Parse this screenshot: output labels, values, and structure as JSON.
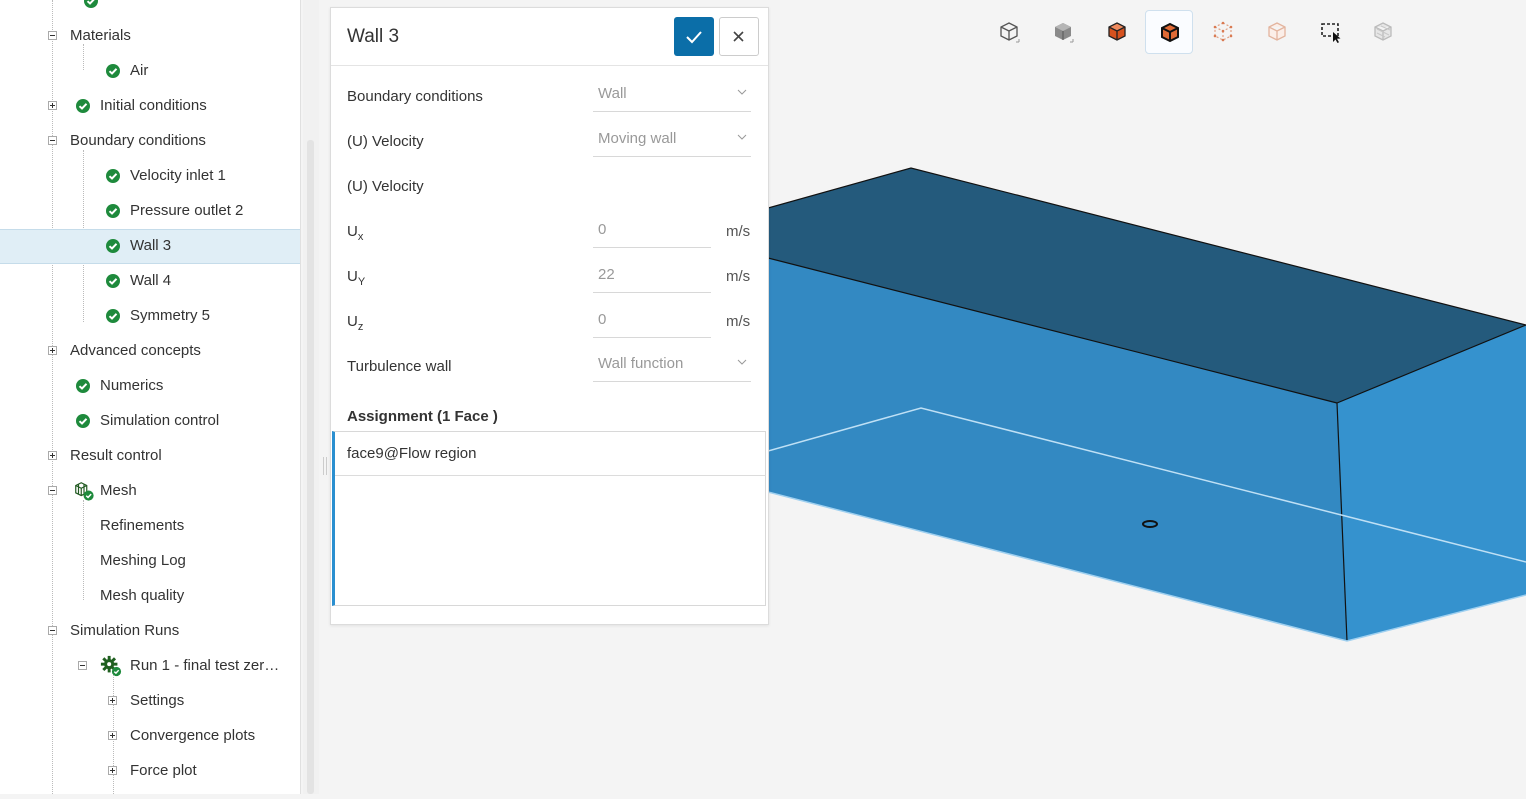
{
  "tree": {
    "items": [
      {
        "label": "Materials",
        "toggle": "minus",
        "icon": "none"
      },
      {
        "label": "Air",
        "toggle": "none",
        "icon": "check-icon"
      },
      {
        "label": "Initial conditions",
        "toggle": "plus",
        "icon": "check-icon"
      },
      {
        "label": "Boundary conditions",
        "toggle": "minus",
        "icon": "none"
      },
      {
        "label": "Velocity inlet 1",
        "toggle": "none",
        "icon": "check-icon"
      },
      {
        "label": "Pressure outlet 2",
        "toggle": "none",
        "icon": "check-icon"
      },
      {
        "label": "Wall 3",
        "toggle": "none",
        "icon": "check-icon",
        "selected": true
      },
      {
        "label": "Wall 4",
        "toggle": "none",
        "icon": "check-icon"
      },
      {
        "label": "Symmetry 5",
        "toggle": "none",
        "icon": "check-icon"
      },
      {
        "label": "Advanced concepts",
        "toggle": "plus",
        "icon": "none"
      },
      {
        "label": "Numerics",
        "toggle": "none",
        "icon": "check-icon"
      },
      {
        "label": "Simulation control",
        "toggle": "none",
        "icon": "check-icon"
      },
      {
        "label": "Result control",
        "toggle": "plus",
        "icon": "none"
      },
      {
        "label": "Mesh",
        "toggle": "minus",
        "icon": "mesh-icon"
      },
      {
        "label": "Refinements",
        "toggle": "none",
        "icon": "none"
      },
      {
        "label": "Meshing Log",
        "toggle": "none",
        "icon": "none"
      },
      {
        "label": "Mesh quality",
        "toggle": "none",
        "icon": "none"
      },
      {
        "label": "Simulation Runs",
        "toggle": "minus",
        "icon": "none"
      },
      {
        "label": "Run 1 - final test zer…",
        "toggle": "minus",
        "icon": "gear-check-icon"
      },
      {
        "label": "Settings",
        "toggle": "plus",
        "icon": "none"
      },
      {
        "label": "Convergence plots",
        "toggle": "plus",
        "icon": "none"
      },
      {
        "label": "Force plot",
        "toggle": "plus",
        "icon": "none"
      }
    ]
  },
  "dialog": {
    "title": "Wall 3",
    "confirm_icon": "checkmark-icon",
    "close_icon": "close-icon",
    "fields": {
      "boundary_conditions": {
        "label": "Boundary conditions",
        "value": "Wall"
      },
      "velocity_type": {
        "label": "(U) Velocity",
        "value": "Moving wall"
      },
      "velocity_header": {
        "label": "(U) Velocity"
      },
      "ux": {
        "label": "U",
        "sub": "x",
        "value": "0",
        "unit": "m/s"
      },
      "uy": {
        "label": "U",
        "sub": "Y",
        "value": "22",
        "unit": "m/s"
      },
      "uz": {
        "label": "U",
        "sub": "z",
        "value": "0",
        "unit": "m/s"
      },
      "turbulence_wall": {
        "label": "Turbulence wall",
        "value": "Wall function"
      }
    },
    "assignment": {
      "title": "Assignment (1 Face )",
      "items": [
        "face9@Flow region"
      ]
    }
  },
  "toolbar": {
    "buttons": [
      {
        "name": "wireframe-cube-icon",
        "active": false
      },
      {
        "name": "solid-cube-icon",
        "active": false
      },
      {
        "name": "orange-solid-cube-icon",
        "active": false
      },
      {
        "name": "orange-edges-cube-icon",
        "active": true
      },
      {
        "name": "points-cube-icon",
        "active": false
      },
      {
        "name": "transparent-cube-icon",
        "active": false
      },
      {
        "name": "box-select-icon",
        "active": false
      },
      {
        "name": "hidden-cube-icon",
        "active": false
      }
    ]
  },
  "colors": {
    "accent": "#0b6ea8",
    "check_green": "#1e8a3c",
    "selected_row": "#e0eef6",
    "box_top": "#245a7c",
    "box_front": "#3389c2",
    "box_side": "#3995d0"
  }
}
